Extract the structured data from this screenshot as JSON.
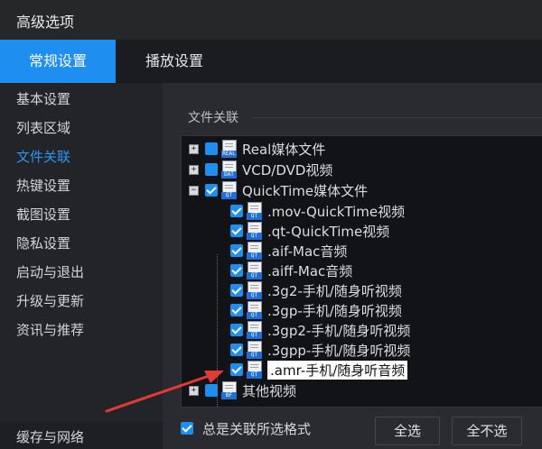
{
  "window": {
    "title": "高级选项"
  },
  "tabs": [
    {
      "label": "常规设置",
      "active": true
    },
    {
      "label": "播放设置",
      "active": false
    }
  ],
  "sidebar": {
    "items": [
      {
        "label": "基本设置",
        "active": false
      },
      {
        "label": "列表区域",
        "active": false
      },
      {
        "label": "文件关联",
        "active": true
      },
      {
        "label": "热键设置",
        "active": false
      },
      {
        "label": "截图设置",
        "active": false
      },
      {
        "label": "隐私设置",
        "active": false
      },
      {
        "label": "启动与退出",
        "active": false
      },
      {
        "label": "升级与更新",
        "active": false
      },
      {
        "label": "资讯与推荐",
        "active": false
      }
    ],
    "bottom_item": "缓存与网络"
  },
  "content": {
    "section_label": "文件关联",
    "tree": [
      {
        "level": 0,
        "expander": "+",
        "checked": false,
        "icon_tag": "REAL",
        "label": "Real媒体文件"
      },
      {
        "level": 0,
        "expander": "+",
        "checked": false,
        "icon_tag": "DAT",
        "label": "VCD/DVD视频"
      },
      {
        "level": 0,
        "expander": "−",
        "checked": true,
        "icon_tag": "QT",
        "label": "QuickTime媒体文件"
      },
      {
        "level": 1,
        "checked": true,
        "icon_tag": "QT",
        "label": ".mov-QuickTime视频"
      },
      {
        "level": 1,
        "checked": true,
        "icon_tag": "QT",
        "label": ".qt-QuickTime视频"
      },
      {
        "level": 1,
        "checked": true,
        "icon_tag": "QT",
        "label": ".aif-Mac音频"
      },
      {
        "level": 1,
        "checked": true,
        "icon_tag": "QT",
        "label": ".aiff-Mac音频"
      },
      {
        "level": 1,
        "checked": true,
        "icon_tag": "QT",
        "label": ".3g2-手机/随身听视频"
      },
      {
        "level": 1,
        "checked": true,
        "icon_tag": "QT",
        "label": ".3gp-手机/随身听视频"
      },
      {
        "level": 1,
        "checked": true,
        "icon_tag": "QT",
        "label": ".3gp2-手机/随身听视频"
      },
      {
        "level": 1,
        "checked": true,
        "icon_tag": "QT",
        "label": ".3gpp-手机/随身听视频"
      },
      {
        "level": 1,
        "checked": true,
        "icon_tag": "QT",
        "label": ".amr-手机/随身听音频",
        "highlighted": true
      },
      {
        "level": 0,
        "expander": "+",
        "checked": false,
        "icon_tag": "BF",
        "label": "其他视频"
      }
    ],
    "always_associate": {
      "label": "总是关联所选格式",
      "checked": true
    },
    "select_all_label": "全选",
    "select_none_label": "全不选"
  },
  "colors": {
    "accent": "#1e8ef0",
    "annotation_arrow": "#e53935"
  }
}
